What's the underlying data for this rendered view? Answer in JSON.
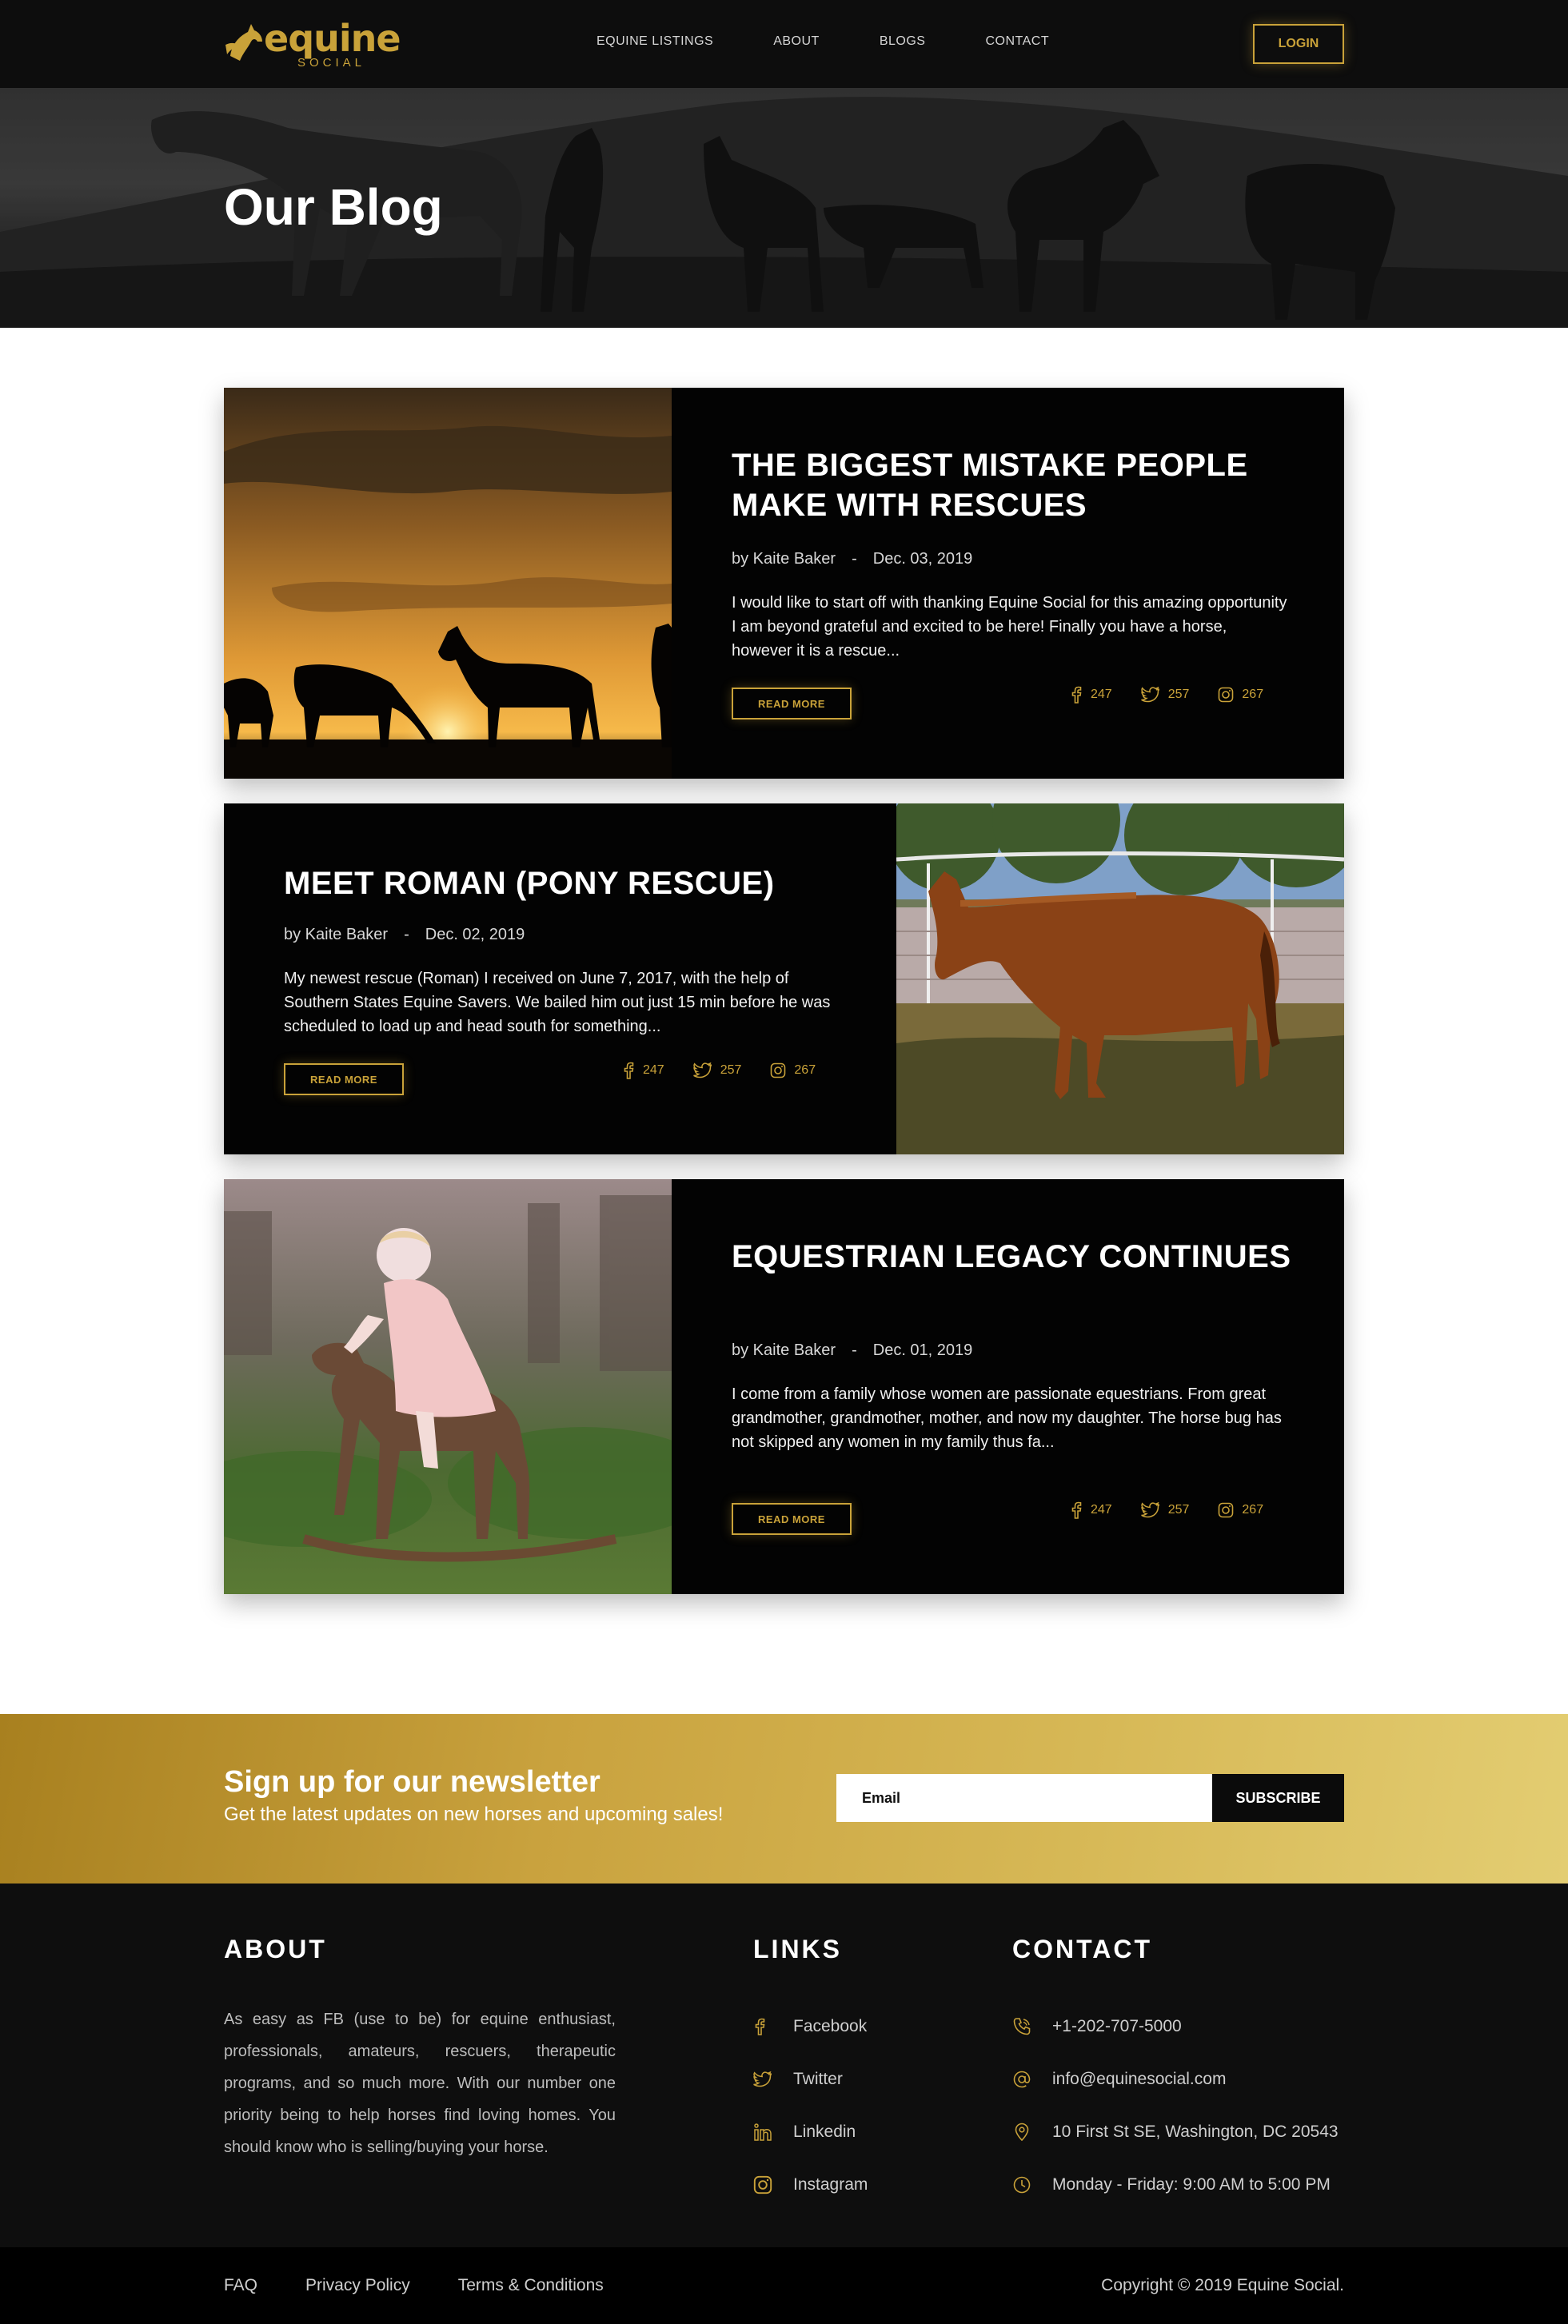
{
  "brand": {
    "logo_text": "equine",
    "logo_sub": "SOCIAL",
    "accent": "#c9a239"
  },
  "nav": {
    "items": [
      "EQUINE LISTINGS",
      "ABOUT",
      "BLOGS",
      "CONTACT"
    ],
    "login_label": "LOGIN"
  },
  "hero": {
    "title": "Our Blog"
  },
  "posts": [
    {
      "title": "THE BIGGEST MISTAKE PEOPLE MAKE WITH RESCUES",
      "author": "by Kaite Baker",
      "separator": "-",
      "date": "Dec. 03, 2019",
      "excerpt": "I would like to start off with thanking Equine Social for this amazing opportunity I am beyond grateful and excited to be here! Finally you have a horse, however it is a rescue...",
      "read_more": "READ MORE",
      "facebook": "247",
      "twitter": "257",
      "instagram": "267"
    },
    {
      "title": "MEET ROMAN (PONY RESCUE)",
      "author": "by Kaite Baker",
      "separator": "-",
      "date": "Dec. 02, 2019",
      "excerpt": "My newest rescue (Roman) I received on June 7, 2017, with the help of Southern States Equine Savers. We bailed him out just 15 min before he was scheduled to load up and head south for something...",
      "read_more": "READ MORE",
      "facebook": "247",
      "twitter": "257",
      "instagram": "267"
    },
    {
      "title": "EQUESTRIAN LEGACY CONTINUES",
      "author": "by Kaite Baker",
      "separator": "-",
      "date": "Dec. 01, 2019",
      "excerpt": "I come from a family whose women are passionate equestrians. From great grandmother, grandmother, mother, and now my daughter. The horse bug has not skipped any women in my family thus fa...",
      "read_more": "READ MORE",
      "facebook": "247",
      "twitter": "257",
      "instagram": "267"
    }
  ],
  "newsletter": {
    "title": "Sign up for our newsletter",
    "subtitle": "Get the latest updates on new horses and upcoming sales!",
    "placeholder": "Email",
    "button": "SUBSCRIBE"
  },
  "footer": {
    "about_title": "ABOUT",
    "about_text": "As easy as FB (use to be) for equine enthusiast, professionals, amateurs, rescuers, therapeutic programs, and so much more. With our number one priority being to help horses find loving homes. You should know who is selling/buying your horse.",
    "links_title": "LINKS",
    "links": [
      "Facebook",
      "Twitter",
      "Linkedin",
      "Instagram"
    ],
    "contact_title": "CONTACT",
    "contact": {
      "phone": "+1-202-707-5000",
      "email": "info@equinesocial.com",
      "address": "10 First St SE, Washington, DC 20543",
      "hours": "Monday - Friday: 9:00 AM to 5:00 PM"
    }
  },
  "bottom": {
    "links": [
      "FAQ",
      "Privacy Policy",
      "Terms & Conditions"
    ],
    "copyright": "Copyright © 2019 Equine Social."
  }
}
